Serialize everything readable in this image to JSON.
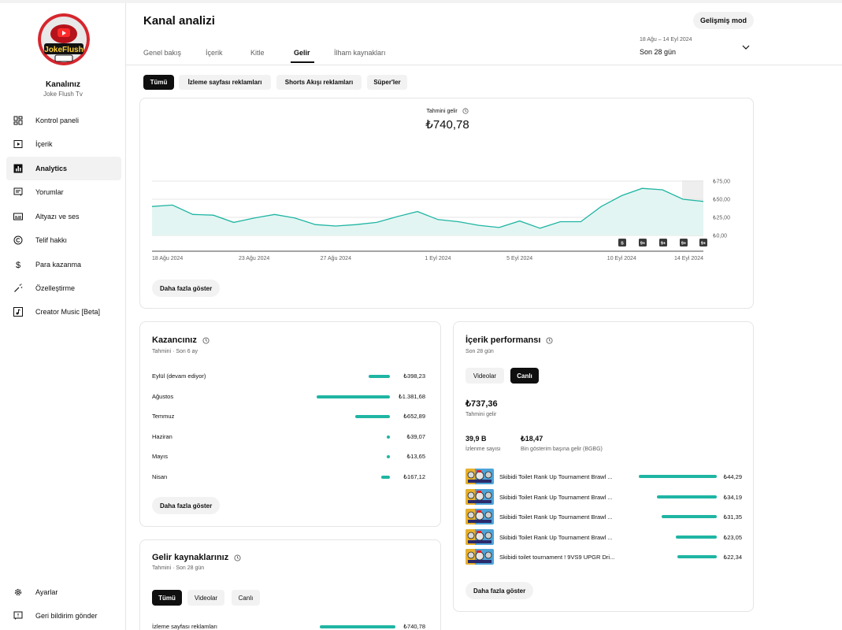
{
  "sidebar": {
    "channel_label": "Kanalınız",
    "channel_name": "Joke Flush Tv",
    "logo_text": "JokeFlush",
    "items": [
      {
        "label": "Kontrol paneli",
        "icon": "dashboard-icon"
      },
      {
        "label": "İçerik",
        "icon": "content-icon"
      },
      {
        "label": "Analytics",
        "icon": "analytics-icon",
        "active": true
      },
      {
        "label": "Yorumlar",
        "icon": "comments-icon"
      },
      {
        "label": "Altyazı ve ses",
        "icon": "subtitles-icon"
      },
      {
        "label": "Telif hakkı",
        "icon": "copyright-icon"
      },
      {
        "label": "Para kazanma",
        "icon": "monetization-icon"
      },
      {
        "label": "Özelleştirme",
        "icon": "customization-icon"
      },
      {
        "label": "Creator Music [Beta]",
        "icon": "music-icon"
      }
    ],
    "bottom_items": [
      {
        "label": "Ayarlar",
        "icon": "settings-icon"
      },
      {
        "label": "Geri bildirim gönder",
        "icon": "feedback-icon"
      }
    ]
  },
  "header": {
    "title": "Kanal analizi",
    "tabs": [
      "Genel bakış",
      "İçerik",
      "Kitle",
      "Gelir",
      "İlham kaynakları"
    ],
    "active_tab": "Gelir",
    "advanced_button": "Gelişmiş mod",
    "date_range": "18 Ağu – 14 Eyl 2024",
    "period": "Son 28 gün"
  },
  "chips": [
    "Tümü",
    "İzleme sayfası reklamları",
    "Shorts Akışı reklamları",
    "Süper'ler"
  ],
  "revenue_card": {
    "label": "Tahmini gelir",
    "value": "₺740,78",
    "more_button": "Daha fazla göster"
  },
  "chart_data": {
    "type": "area",
    "title": "Tahmini gelir",
    "x_tick_labels": [
      "18 Ağu 2024",
      "23 Ağu 2024",
      "27 Ağu 2024",
      "1 Eyl 2024",
      "5 Eyl 2024",
      "10 Eyl 2024",
      "14 Eyl 2024"
    ],
    "y_tick_labels": [
      "₺0,00",
      "₺25,00",
      "₺50,00",
      "₺75,00"
    ],
    "ylim": [
      0,
      75
    ],
    "x": [
      "18 Ağu",
      "19 Ağu",
      "20 Ağu",
      "21 Ağu",
      "22 Ağu",
      "23 Ağu",
      "24 Ağu",
      "25 Ağu",
      "26 Ağu",
      "27 Ağu",
      "28 Ağu",
      "29 Ağu",
      "30 Ağu",
      "31 Ağu",
      "1 Eyl",
      "2 Eyl",
      "3 Eyl",
      "4 Eyl",
      "5 Eyl",
      "6 Eyl",
      "7 Eyl",
      "8 Eyl",
      "9 Eyl",
      "10 Eyl",
      "11 Eyl",
      "12 Eyl",
      "13 Eyl",
      "14 Eyl"
    ],
    "values": [
      40,
      42,
      29,
      28,
      18,
      24,
      29,
      24,
      15,
      13,
      15,
      18,
      26,
      33,
      22,
      19,
      14,
      11,
      20,
      10,
      19,
      19,
      40,
      55,
      65,
      63,
      50,
      47
    ],
    "markers": [
      "S",
      "9+",
      "9+",
      "9+",
      "9+"
    ],
    "color": "#1fb5a3"
  },
  "earnings": {
    "title": "Kazancınız",
    "subtitle": "Tahmini · Son 6 ay",
    "rows": [
      {
        "label": "Eylül (devam ediyor)",
        "value": "₺398,23",
        "amount": 398.23
      },
      {
        "label": "Ağustos",
        "value": "₺1.381,68",
        "amount": 1381.68
      },
      {
        "label": "Temmuz",
        "value": "₺652,89",
        "amount": 652.89
      },
      {
        "label": "Haziran",
        "value": "₺39,07",
        "amount": 39.07
      },
      {
        "label": "Mayıs",
        "value": "₺13,65",
        "amount": 13.65
      },
      {
        "label": "Nisan",
        "value": "₺167,12",
        "amount": 167.12
      }
    ],
    "more_button": "Daha fazla göster"
  },
  "content_perf": {
    "title": "İçerik performansı",
    "subtitle": "Son 28 gün",
    "toggles": [
      "Videolar",
      "Canlı"
    ],
    "active_toggle": "Canlı",
    "revenue_value": "₺737,36",
    "revenue_label": "Tahmini gelir",
    "views_value": "39,9 B",
    "views_label": "İzlenme sayısı",
    "rpm_value": "₺18,47",
    "rpm_label": "Bin gösterim başına gelir (BGBG)",
    "rows": [
      {
        "title": "Skibidi Toilet Rank Up Tournament Brawl ...",
        "value": "₺44,29",
        "amount": 44.29
      },
      {
        "title": "Skibidi Toilet Rank Up Tournament Brawl ...",
        "value": "₺34,19",
        "amount": 34.19
      },
      {
        "title": "Skibidi Toilet Rank Up Tournament Brawl ...",
        "value": "₺31,35",
        "amount": 31.35
      },
      {
        "title": "Skibidi Toilet Rank Up Tournament Brawl ...",
        "value": "₺23,05",
        "amount": 23.05
      },
      {
        "title": "Skibidi toilet tournament ! 9VS9 UPGR Dri...",
        "value": "₺22,34",
        "amount": 22.34
      }
    ],
    "more_button": "Daha fazla göster"
  },
  "sources": {
    "title": "Gelir kaynaklarınız",
    "subtitle": "Tahmini · Son 28 gün",
    "toggles": [
      "Tümü",
      "Videolar",
      "Canlı"
    ],
    "active_toggle": "Tümü",
    "rows": [
      {
        "label": "İzleme sayfası reklamları",
        "value": "₺740,78",
        "amount": 740.78
      }
    ]
  }
}
